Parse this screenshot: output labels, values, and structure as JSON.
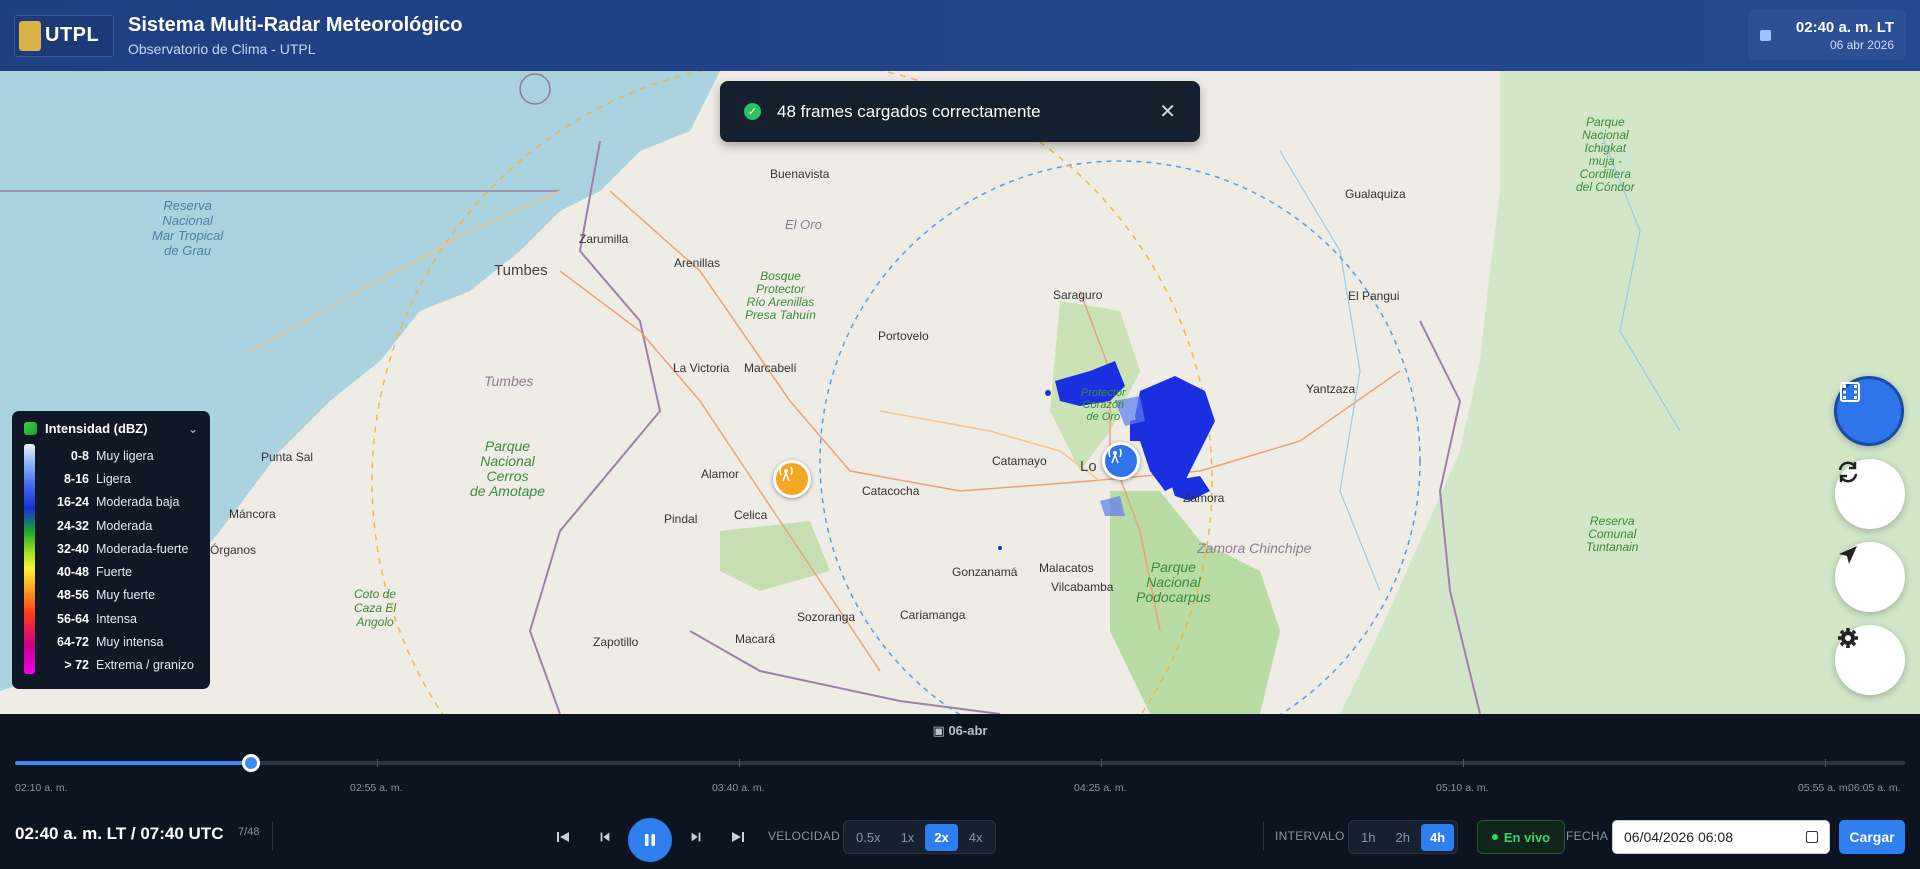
{
  "header": {
    "logo_text": "UTPL",
    "title": "Sistema Multi-Radar Meteorológico",
    "subtitle": "Observatorio de Clima - UTPL",
    "clock_time": "02:40 a. m. LT",
    "clock_date": "06 abr 2026"
  },
  "toast": {
    "message": "48 frames cargados correctamente",
    "close_icon": "close-icon"
  },
  "map": {
    "labels": {
      "buenavista": "Buenavista",
      "el_oro": "El Oro",
      "gualaquiza": "Gualaquiza",
      "zarumilla": "Zarumilla",
      "tumbes_city": "Tumbes",
      "arenillas": "Arenillas",
      "saraguro": "Saraguro",
      "el_pangui": "El Pangui",
      "portovelo": "Portovelo",
      "la_victoria": "La Victoria",
      "marcabeli": "Marcabelí",
      "tumbes_region": "Tumbes",
      "yantzaza": "Yantzaza",
      "punta_sal": "Punta Sal",
      "alamor": "Alamor",
      "catamayo": "Catamayo",
      "loja": "Lo",
      "zamora": "Zamora",
      "catacocha": "Catacocha",
      "mancora": "Máncora",
      "pindal": "Pindal",
      "celica": "Celica",
      "organos": "Órganos",
      "zamora_chinchipe": "Zamora Chinchipe",
      "gonzanama": "Gonzanamá",
      "malacatos": "Malacatos",
      "vilcabamba": "Vilcabamba",
      "sozoranga": "Sozoranga",
      "cariamanga": "Cariamanga",
      "zapotillo": "Zapotillo",
      "macara": "Macará",
      "reserva_mar": "Reserva\nNacional\nMar Tropical\nde Grau",
      "bosque_arenillas": "Bosque\nProtector\nRío Arenillas\nPresa Tahuín",
      "parque_amotape": "Parque\nNacional\nCerros\nde Amotape",
      "coto_caza": "Coto de\nCaza El\nAngolo",
      "podocarpus": "Parque\nNacional\nPodocarpus",
      "corazon_oro": "Protector\nCorazón\nde Oro",
      "ichigkat": "Parque\nNacional\nIchigkat\nmuja -\nCordillera\ndel Cóndor",
      "tuntanain": "Reserva\nComunal\nTuntanain"
    }
  },
  "legend": {
    "title": "Intensidad (dBZ)",
    "rows": [
      {
        "range": "0-8",
        "label": "Muy ligera"
      },
      {
        "range": "8-16",
        "label": "Ligera"
      },
      {
        "range": "16-24",
        "label": "Moderada baja"
      },
      {
        "range": "24-32",
        "label": "Moderada"
      },
      {
        "range": "32-40",
        "label": "Moderada-fuerte"
      },
      {
        "range": "40-48",
        "label": "Fuerte"
      },
      {
        "range": "48-56",
        "label": "Muy fuerte"
      },
      {
        "range": "56-64",
        "label": "Intensa"
      },
      {
        "range": "64-72",
        "label": "Muy intensa"
      },
      {
        "range": "> 72",
        "label": "Extrema / granizo"
      }
    ]
  },
  "fab": [
    "film-icon",
    "refresh-icon",
    "locate-icon",
    "gear-icon"
  ],
  "timeline": {
    "date": "06-abr",
    "progress": 0.125,
    "ticks": [
      "02:10 a. m.",
      "02:55 a. m.",
      "03:40 a. m.",
      "04:25 a. m.",
      "05:10 a. m.",
      "05:55 a. m.",
      "06:05 a. m."
    ]
  },
  "controls": {
    "current_time": "02:40 a. m. LT / 07:40 UTC",
    "frame_counter": "7/48",
    "speed_label": "VELOCIDAD",
    "speeds": [
      "0.5x",
      "1x",
      "2x",
      "4x"
    ],
    "speed_selected": "2x",
    "interval_label": "INTERVALO",
    "intervals": [
      "1h",
      "2h",
      "4h"
    ],
    "interval_selected": "4h",
    "live_label": "En vivo",
    "date_label": "FECHA",
    "date_value": "06/04/2026 06:08",
    "load_label": "Cargar"
  }
}
